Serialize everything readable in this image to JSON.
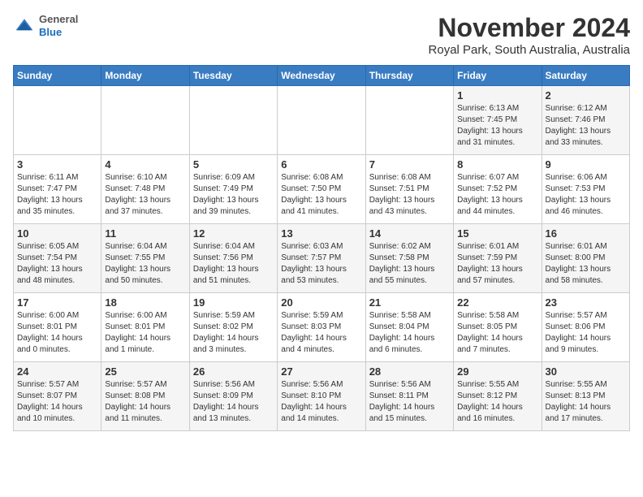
{
  "header": {
    "logo_general": "General",
    "logo_blue": "Blue",
    "month_year": "November 2024",
    "location": "Royal Park, South Australia, Australia"
  },
  "weekdays": [
    "Sunday",
    "Monday",
    "Tuesday",
    "Wednesday",
    "Thursday",
    "Friday",
    "Saturday"
  ],
  "weeks": [
    [
      {
        "day": "",
        "info": ""
      },
      {
        "day": "",
        "info": ""
      },
      {
        "day": "",
        "info": ""
      },
      {
        "day": "",
        "info": ""
      },
      {
        "day": "",
        "info": ""
      },
      {
        "day": "1",
        "info": "Sunrise: 6:13 AM\nSunset: 7:45 PM\nDaylight: 13 hours\nand 31 minutes."
      },
      {
        "day": "2",
        "info": "Sunrise: 6:12 AM\nSunset: 7:46 PM\nDaylight: 13 hours\nand 33 minutes."
      }
    ],
    [
      {
        "day": "3",
        "info": "Sunrise: 6:11 AM\nSunset: 7:47 PM\nDaylight: 13 hours\nand 35 minutes."
      },
      {
        "day": "4",
        "info": "Sunrise: 6:10 AM\nSunset: 7:48 PM\nDaylight: 13 hours\nand 37 minutes."
      },
      {
        "day": "5",
        "info": "Sunrise: 6:09 AM\nSunset: 7:49 PM\nDaylight: 13 hours\nand 39 minutes."
      },
      {
        "day": "6",
        "info": "Sunrise: 6:08 AM\nSunset: 7:50 PM\nDaylight: 13 hours\nand 41 minutes."
      },
      {
        "day": "7",
        "info": "Sunrise: 6:08 AM\nSunset: 7:51 PM\nDaylight: 13 hours\nand 43 minutes."
      },
      {
        "day": "8",
        "info": "Sunrise: 6:07 AM\nSunset: 7:52 PM\nDaylight: 13 hours\nand 44 minutes."
      },
      {
        "day": "9",
        "info": "Sunrise: 6:06 AM\nSunset: 7:53 PM\nDaylight: 13 hours\nand 46 minutes."
      }
    ],
    [
      {
        "day": "10",
        "info": "Sunrise: 6:05 AM\nSunset: 7:54 PM\nDaylight: 13 hours\nand 48 minutes."
      },
      {
        "day": "11",
        "info": "Sunrise: 6:04 AM\nSunset: 7:55 PM\nDaylight: 13 hours\nand 50 minutes."
      },
      {
        "day": "12",
        "info": "Sunrise: 6:04 AM\nSunset: 7:56 PM\nDaylight: 13 hours\nand 51 minutes."
      },
      {
        "day": "13",
        "info": "Sunrise: 6:03 AM\nSunset: 7:57 PM\nDaylight: 13 hours\nand 53 minutes."
      },
      {
        "day": "14",
        "info": "Sunrise: 6:02 AM\nSunset: 7:58 PM\nDaylight: 13 hours\nand 55 minutes."
      },
      {
        "day": "15",
        "info": "Sunrise: 6:01 AM\nSunset: 7:59 PM\nDaylight: 13 hours\nand 57 minutes."
      },
      {
        "day": "16",
        "info": "Sunrise: 6:01 AM\nSunset: 8:00 PM\nDaylight: 13 hours\nand 58 minutes."
      }
    ],
    [
      {
        "day": "17",
        "info": "Sunrise: 6:00 AM\nSunset: 8:01 PM\nDaylight: 14 hours\nand 0 minutes."
      },
      {
        "day": "18",
        "info": "Sunrise: 6:00 AM\nSunset: 8:01 PM\nDaylight: 14 hours\nand 1 minute."
      },
      {
        "day": "19",
        "info": "Sunrise: 5:59 AM\nSunset: 8:02 PM\nDaylight: 14 hours\nand 3 minutes."
      },
      {
        "day": "20",
        "info": "Sunrise: 5:59 AM\nSunset: 8:03 PM\nDaylight: 14 hours\nand 4 minutes."
      },
      {
        "day": "21",
        "info": "Sunrise: 5:58 AM\nSunset: 8:04 PM\nDaylight: 14 hours\nand 6 minutes."
      },
      {
        "day": "22",
        "info": "Sunrise: 5:58 AM\nSunset: 8:05 PM\nDaylight: 14 hours\nand 7 minutes."
      },
      {
        "day": "23",
        "info": "Sunrise: 5:57 AM\nSunset: 8:06 PM\nDaylight: 14 hours\nand 9 minutes."
      }
    ],
    [
      {
        "day": "24",
        "info": "Sunrise: 5:57 AM\nSunset: 8:07 PM\nDaylight: 14 hours\nand 10 minutes."
      },
      {
        "day": "25",
        "info": "Sunrise: 5:57 AM\nSunset: 8:08 PM\nDaylight: 14 hours\nand 11 minutes."
      },
      {
        "day": "26",
        "info": "Sunrise: 5:56 AM\nSunset: 8:09 PM\nDaylight: 14 hours\nand 13 minutes."
      },
      {
        "day": "27",
        "info": "Sunrise: 5:56 AM\nSunset: 8:10 PM\nDaylight: 14 hours\nand 14 minutes."
      },
      {
        "day": "28",
        "info": "Sunrise: 5:56 AM\nSunset: 8:11 PM\nDaylight: 14 hours\nand 15 minutes."
      },
      {
        "day": "29",
        "info": "Sunrise: 5:55 AM\nSunset: 8:12 PM\nDaylight: 14 hours\nand 16 minutes."
      },
      {
        "day": "30",
        "info": "Sunrise: 5:55 AM\nSunset: 8:13 PM\nDaylight: 14 hours\nand 17 minutes."
      }
    ]
  ]
}
